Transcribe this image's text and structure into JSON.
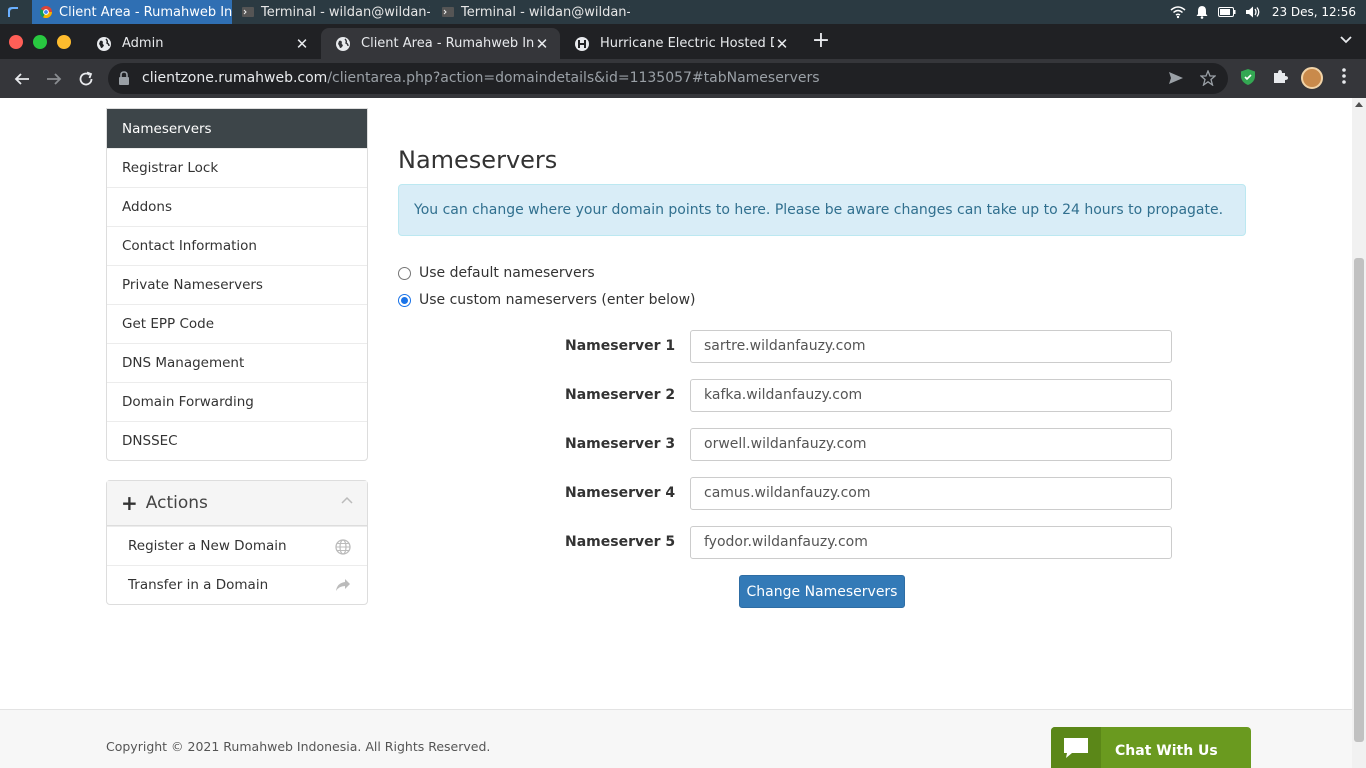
{
  "taskbar": {
    "tasks": [
      {
        "label": "Client Area - Rumahweb Ind..."
      },
      {
        "label": "Terminal - wildan@wildan-T..."
      },
      {
        "label": "Terminal - wildan@wildan-T..."
      }
    ],
    "clock": "23 Des, 12:56"
  },
  "browser": {
    "tabs": [
      {
        "title": "Admin"
      },
      {
        "title": "Client Area - Rumahweb Indonesia"
      },
      {
        "title": "Hurricane Electric Hosted DNS"
      }
    ],
    "url_host": "clientzone.rumahweb.com",
    "url_path": "/clientarea.php?action=domaindetails&id=1135057#tabNameservers"
  },
  "sidebar": {
    "items": [
      {
        "label": "Nameservers"
      },
      {
        "label": "Registrar Lock"
      },
      {
        "label": "Addons"
      },
      {
        "label": "Contact Information"
      },
      {
        "label": "Private Nameservers"
      },
      {
        "label": "Get EPP Code"
      },
      {
        "label": "DNS Management"
      },
      {
        "label": "Domain Forwarding"
      },
      {
        "label": "DNSSEC"
      }
    ]
  },
  "actions": {
    "title": "Actions",
    "items": [
      {
        "label": "Register a New Domain"
      },
      {
        "label": "Transfer in a Domain"
      }
    ]
  },
  "main": {
    "title": "Nameservers",
    "alert": "You can change where your domain points to here. Please be aware changes can take up to 24 hours to propagate.",
    "radio_default": "Use default nameservers",
    "radio_custom": "Use custom nameservers (enter below)",
    "nameservers": [
      {
        "label": "Nameserver 1",
        "value": "sartre.wildanfauzy.com"
      },
      {
        "label": "Nameserver 2",
        "value": "kafka.wildanfauzy.com"
      },
      {
        "label": "Nameserver 3",
        "value": "orwell.wildanfauzy.com"
      },
      {
        "label": "Nameserver 4",
        "value": "camus.wildanfauzy.com"
      },
      {
        "label": "Nameserver 5",
        "value": "fyodor.wildanfauzy.com"
      }
    ],
    "submit_label": "Change Nameservers"
  },
  "footer": {
    "copyright": "Copyright © 2021 Rumahweb Indonesia. All Rights Reserved.",
    "chat_label": "Chat With Us"
  },
  "colors": {
    "primary": "#337ab7",
    "sidebar_active": "#3d4549",
    "alert_bg": "#d9edf7",
    "chat": "#6a9a1f"
  }
}
